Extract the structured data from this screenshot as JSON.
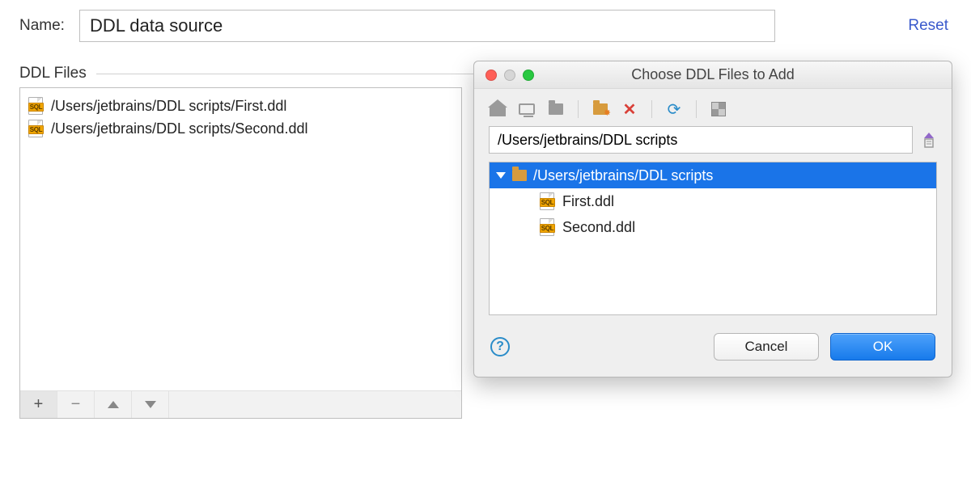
{
  "form": {
    "name_label": "Name:",
    "name_value": "DDL data source",
    "reset_label": "Reset",
    "files_section_label": "DDL Files"
  },
  "files_list": {
    "items": [
      {
        "path": "/Users/jetbrains/DDL scripts/First.ddl"
      },
      {
        "path": "/Users/jetbrains/DDL scripts/Second.ddl"
      }
    ]
  },
  "files_toolbar": {
    "add": "+",
    "remove": "−"
  },
  "dialog": {
    "title": "Choose DDL Files to Add",
    "path_value": "/Users/jetbrains/DDL scripts",
    "tree": {
      "root": {
        "label": "/Users/jetbrains/DDL scripts",
        "expanded": true,
        "selected": true
      },
      "children": [
        {
          "label": "First.ddl"
        },
        {
          "label": "Second.ddl"
        }
      ]
    },
    "cancel_label": "Cancel",
    "ok_label": "OK"
  }
}
